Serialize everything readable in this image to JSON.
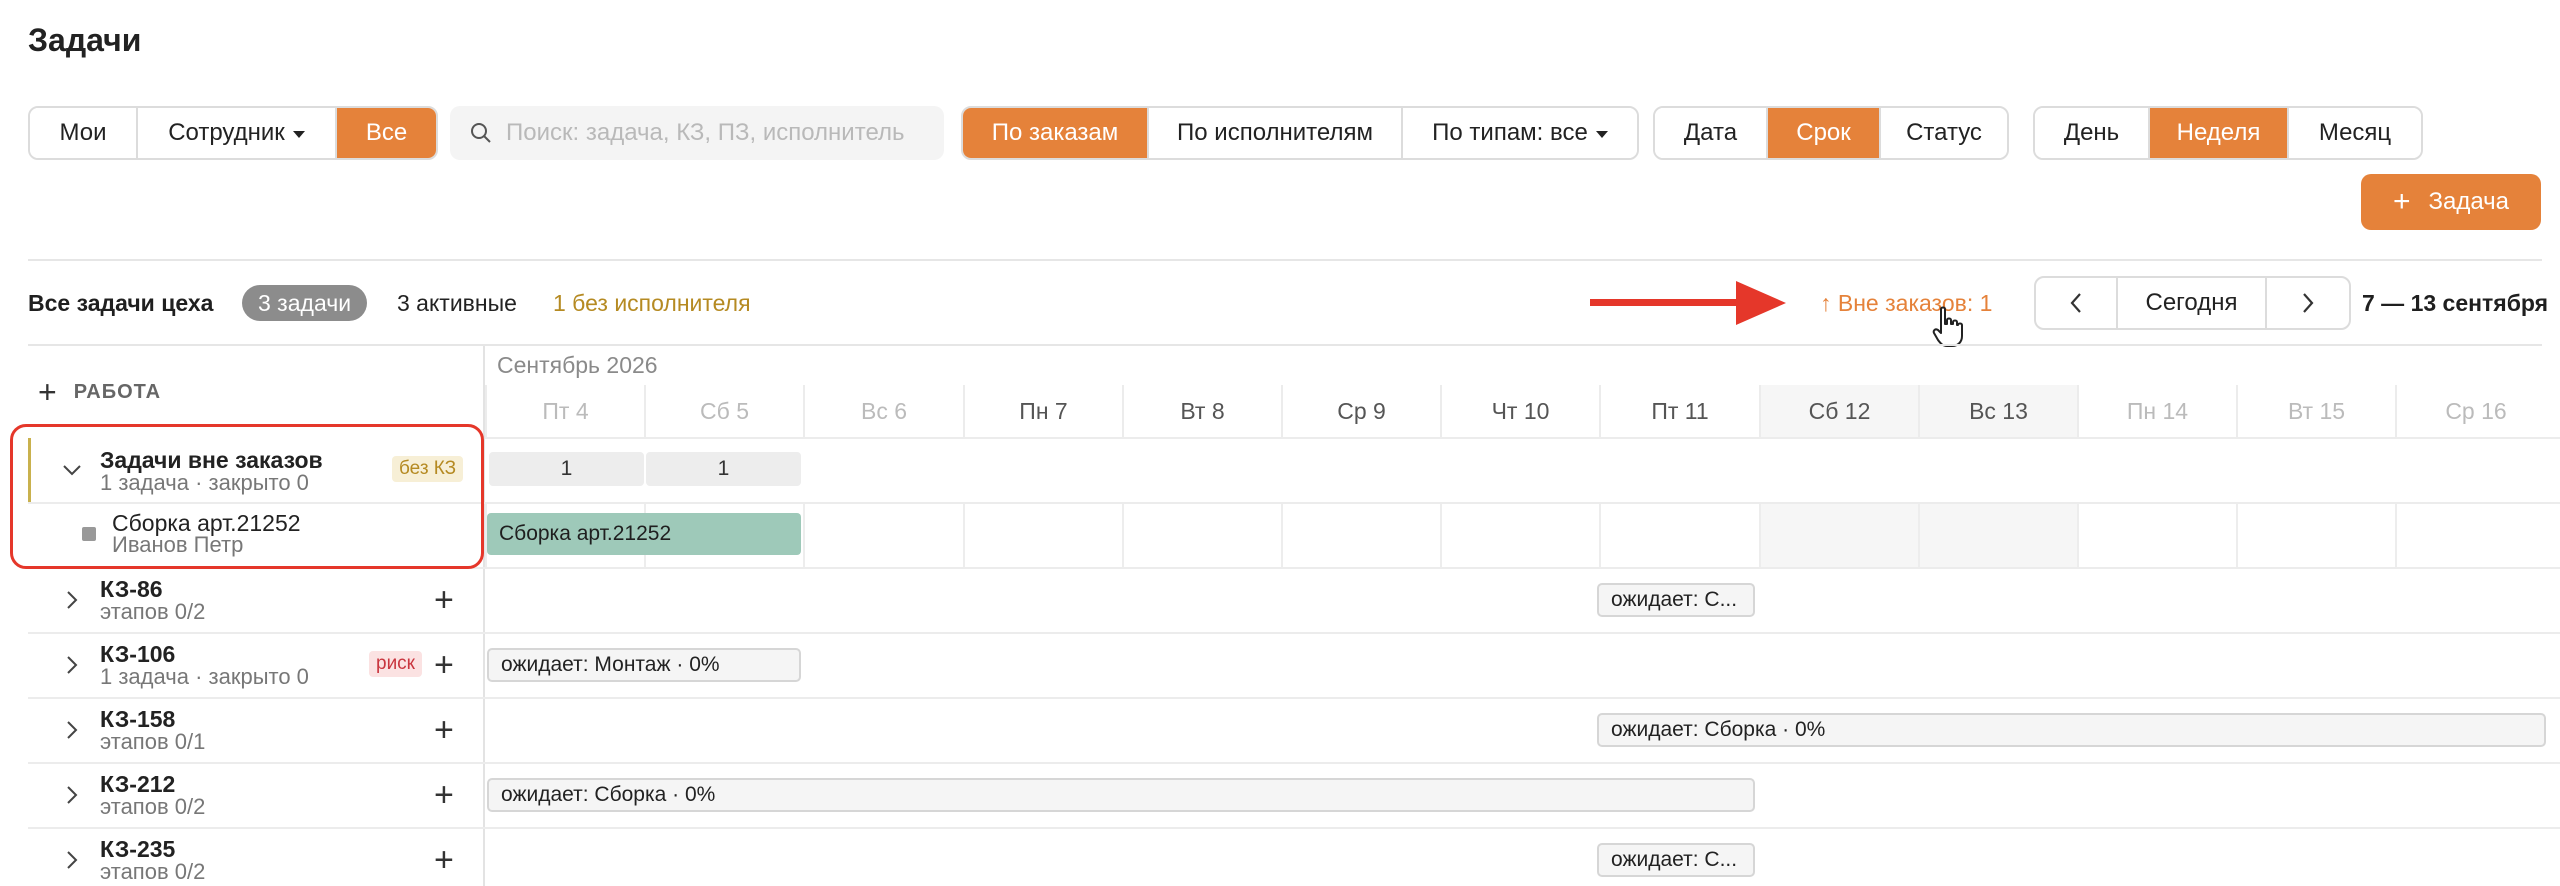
{
  "page": {
    "title": "Задачи"
  },
  "toolbar": {
    "scope": {
      "mine": "Мои",
      "employee": "Сотрудник",
      "all": "Все"
    },
    "search": {
      "placeholder": "Поиск: задача, КЗ, ПЗ, исполнитель"
    },
    "grouping": {
      "by_orders": "По заказам",
      "by_assignees": "По исполнителям",
      "by_types": "По типам: все"
    },
    "sort": {
      "date": "Дата",
      "deadline": "Срок",
      "status": "Статус"
    },
    "period": {
      "day": "День",
      "week": "Неделя",
      "month": "Месяц"
    },
    "add_task": "Задача"
  },
  "summary": {
    "title": "Все задачи цеха",
    "tasks_count": "3 задачи",
    "active": "3 активные",
    "unassigned": "1 без исполнителя",
    "outside_orders": "↑ Вне заказов: 1",
    "today": "Сегодня",
    "range": "7 — 13 сентября"
  },
  "calendar": {
    "work_label": "РАБОТА",
    "month": "Сентябрь 2026",
    "days": [
      "Пт 4",
      "Сб 5",
      "Вс 6",
      "Пн 7",
      "Вт 8",
      "Ср 9",
      "Чт 10",
      "Пт 11",
      "Сб 12",
      "Вс 13",
      "Пн 14",
      "Вт 15",
      "Ср 16"
    ]
  },
  "rows": {
    "group": {
      "name": "Задачи вне заказов",
      "sub": "1 задача · закрыто 0",
      "tag": "без КЗ",
      "counts": [
        "1",
        "1"
      ]
    },
    "subtask": {
      "name": "Сборка арт.21252",
      "owner": "Иванов Петр",
      "bar": "Сборка арт.21252"
    },
    "kz86": {
      "name": "КЗ-86",
      "sub": "этапов 0/2",
      "bar": "ожидает: С..."
    },
    "kz106": {
      "name": "КЗ-106",
      "sub": "1 задача · закрыто 0",
      "tag": "риск",
      "bar": "ожидает: Монтаж · 0%"
    },
    "kz158": {
      "name": "КЗ-158",
      "sub": "этапов 0/1",
      "bar": "ожидает: Сборка · 0%"
    },
    "kz212": {
      "name": "КЗ-212",
      "sub": "этапов 0/2",
      "bar": "ожидает: Сборка · 0%"
    },
    "kz235": {
      "name": "КЗ-235",
      "sub": "этапов 0/2",
      "bar": "ожидает: С..."
    }
  },
  "colors": {
    "accent": "#e5823a",
    "highlight": "#e5372a",
    "bar_green": "#9ec9b9",
    "warning_text": "#b58a22"
  },
  "icons": [
    "search-icon",
    "plus-icon",
    "chevron-left-icon",
    "chevron-right-icon",
    "chevron-down-icon",
    "caret-down-icon",
    "pointer-hand-icon",
    "arrow-right-icon"
  ]
}
